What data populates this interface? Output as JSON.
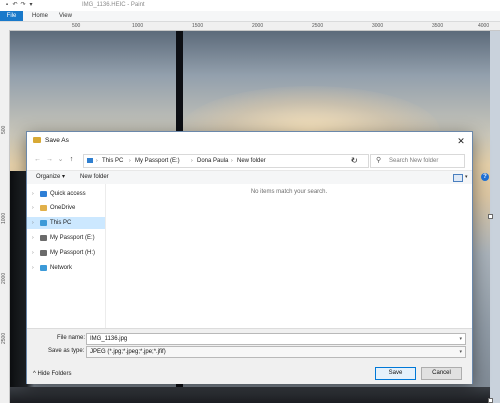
{
  "paint": {
    "window_title": "IMG_1136.HEIC - Paint",
    "quick_access_icons": [
      "save-icon",
      "undo-icon",
      "redo-icon",
      "customize-icon"
    ],
    "tabs": [
      "File",
      "Home",
      "View"
    ],
    "ruler_top_labels": [
      "500",
      "1000",
      "1500",
      "2000",
      "2500",
      "3000",
      "3500",
      "4000"
    ],
    "ruler_left_labels": [
      "500",
      "1000",
      "1500",
      "2000",
      "2500"
    ]
  },
  "dialog": {
    "title": "Save As",
    "close_glyph": "✕",
    "nav": {
      "back_glyph": "←",
      "forward_glyph": "→",
      "recent_glyph": "⌄",
      "up_glyph": "↑",
      "refresh_glyph": "↻"
    },
    "breadcrumbs": [
      "This PC",
      "My Passport (E:)",
      "Dona Paula",
      "New folder"
    ],
    "search_placeholder": "Search New folder",
    "organize_label": "Organize ▾",
    "new_folder_label": "New folder",
    "help_glyph": "?",
    "nav_pane": [
      {
        "label": "Quick access",
        "icon": "star-icon",
        "color": "#2e7fd6"
      },
      {
        "label": "OneDrive",
        "icon": "folder-icon",
        "color": "#e1b04a"
      },
      {
        "label": "This PC",
        "icon": "computer-icon",
        "color": "#3c9ad8",
        "selected": true
      },
      {
        "label": "My Passport (E:)",
        "icon": "drive-icon",
        "color": "#6b6b6b"
      },
      {
        "label": "My Passport (H:)",
        "icon": "drive-icon",
        "color": "#6b6b6b"
      },
      {
        "label": "Network",
        "icon": "network-icon",
        "color": "#3c9ad8"
      }
    ],
    "empty_message": "No items match your search.",
    "file_name_label": "File name:",
    "file_name_value": "IMG_1136.jpg",
    "save_as_type_label": "Save as type:",
    "save_as_type_value": "JPEG (*.jpg;*.jpeg;*.jpe;*.jfif)",
    "hide_folders_label": "Hide Folders",
    "save_button": "Save",
    "cancel_button": "Cancel"
  }
}
